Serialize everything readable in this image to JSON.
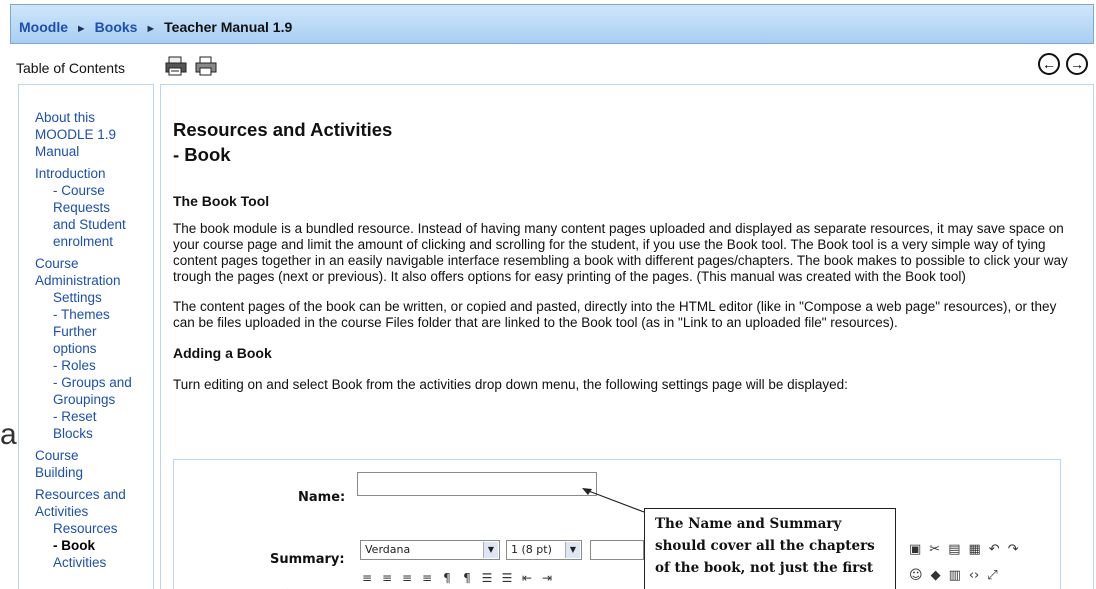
{
  "breadcrumb": {
    "items": [
      "Moodle",
      "Books"
    ],
    "separator": "►",
    "current": "Teacher Manual 1.9"
  },
  "toc": {
    "header": "Table of Contents",
    "lines": [
      {
        "text": "About this",
        "kind": "item"
      },
      {
        "text": "MOODLE 1.9",
        "kind": "item"
      },
      {
        "text": "Manual",
        "kind": "item"
      },
      {
        "text": "Introduction",
        "kind": "item-gap"
      },
      {
        "text": "- Course",
        "kind": "sub"
      },
      {
        "text": "Requests",
        "kind": "sub"
      },
      {
        "text": "and Student",
        "kind": "sub"
      },
      {
        "text": "enrolment",
        "kind": "sub"
      },
      {
        "text": "Course",
        "kind": "item-gap"
      },
      {
        "text": "Administration",
        "kind": "item"
      },
      {
        "text": "Settings",
        "kind": "sub"
      },
      {
        "text": "- Themes",
        "kind": "sub"
      },
      {
        "text": "Further",
        "kind": "sub"
      },
      {
        "text": "options",
        "kind": "sub"
      },
      {
        "text": "- Roles",
        "kind": "sub"
      },
      {
        "text": "- Groups and",
        "kind": "sub"
      },
      {
        "text": "Groupings",
        "kind": "sub"
      },
      {
        "text": "- Reset",
        "kind": "sub"
      },
      {
        "text": "Blocks",
        "kind": "sub"
      },
      {
        "text": "Course",
        "kind": "item-gap"
      },
      {
        "text": "Building",
        "kind": "item"
      },
      {
        "text": "Resources and",
        "kind": "item-gap"
      },
      {
        "text": "Activities",
        "kind": "item"
      },
      {
        "text": "Resources",
        "kind": "sub"
      },
      {
        "text": "- Book",
        "kind": "current"
      },
      {
        "text": "Activities",
        "kind": "sub"
      }
    ]
  },
  "stray_letter": "a",
  "content": {
    "title_line1": "Resources and Activities",
    "title_line2": "- Book",
    "section1": "The Book Tool",
    "para1": "The book module is a bundled resource. Instead of having many content pages uploaded and displayed as separate resources, it may save space on your course page and limit the amount of clicking and scrolling for the student, if you use the Book tool. The Book tool is a very simple way of tying content pages together in an easily navigable interface resembling a book with different pages/chapters. The book makes to possible to click your way trough the pages (next or previous). It also offers options for easy printing of the pages. (This manual was created with the Book tool)",
    "para2": "The content pages of the book can be written, or copied and pasted, directly into the HTML editor (like in \"Compose a web page\" resources), or they can be files uploaded in the course Files folder that are linked to the Book tool (as in \"Link to an uploaded file\" resources).",
    "section2": "Adding a Book",
    "para3": "Turn editing on and select Book from the activities drop down menu, the following settings page will be displayed:"
  },
  "form": {
    "name_label": "Name:",
    "summary_label": "Summary:",
    "font_select": "Verdana",
    "size_select": "1 (8 pt)",
    "callout_text": "The Name and Summary should cover all the chapters of the book, not just the first"
  },
  "icons": {
    "print_book": "print-book-icon",
    "print_chapter": "print-chapter-icon",
    "prev": "←",
    "next": "→"
  }
}
